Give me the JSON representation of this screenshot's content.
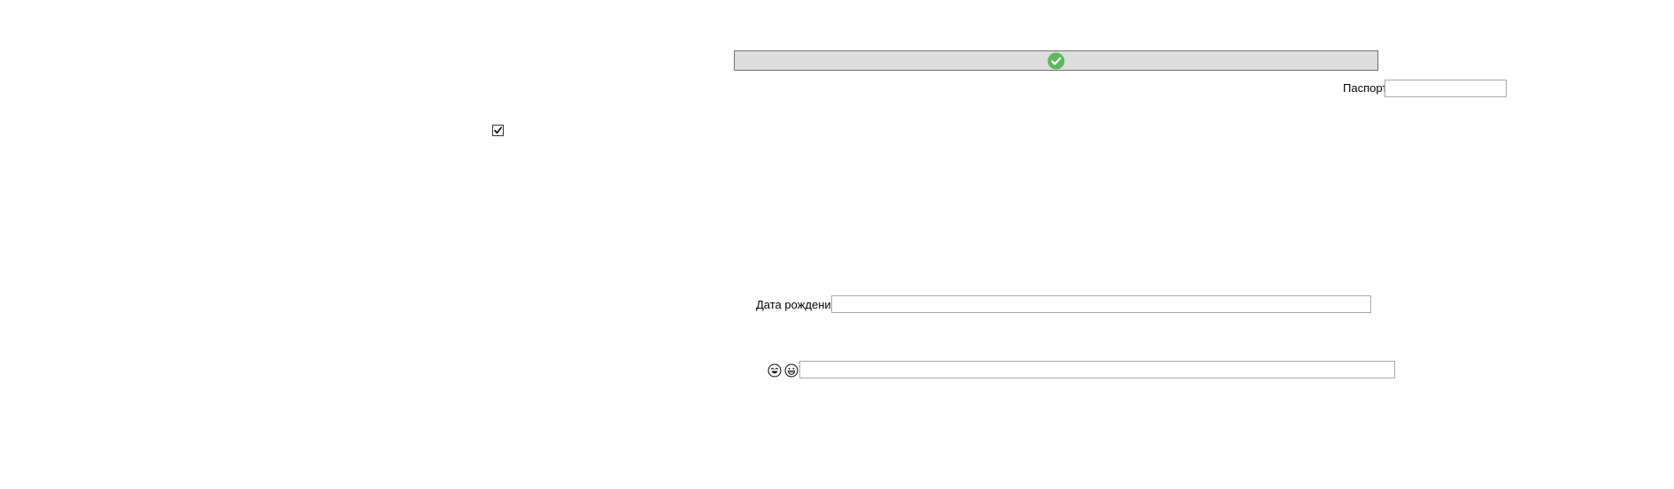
{
  "top_bar": {
    "icon": "check-circle-icon",
    "icon_color": "#5cb85c",
    "background": "#dddddd"
  },
  "passport": {
    "label": "Паспорт",
    "value": ""
  },
  "checkbox": {
    "checked": true
  },
  "birth_date": {
    "label": "Дата рождения",
    "value": ""
  },
  "bottom_row": {
    "icons": [
      "laughing-face-icon",
      "grinning-face-icon"
    ],
    "value": ""
  }
}
